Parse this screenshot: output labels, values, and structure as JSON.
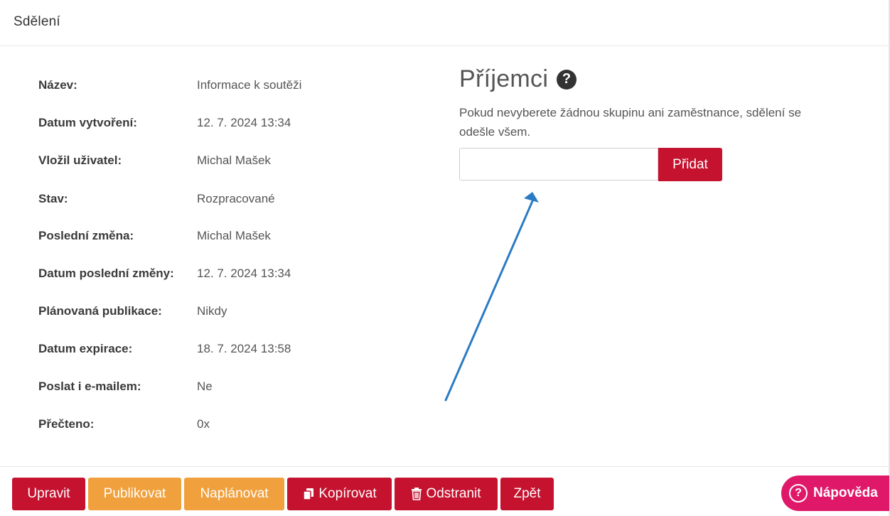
{
  "header": {
    "title": "Sdělení"
  },
  "details": [
    {
      "label": "Název:",
      "value": "Informace k soutěži"
    },
    {
      "label": "Datum vytvoření:",
      "value": "12. 7. 2024 13:34"
    },
    {
      "label": "Vložil uživatel:",
      "value": "Michal Mašek"
    },
    {
      "label": "Stav:",
      "value": "Rozpracované"
    },
    {
      "label": "Poslední změna:",
      "value": "Michal Mašek"
    },
    {
      "label": "Datum poslední změny:",
      "value": "12. 7. 2024 13:34"
    },
    {
      "label": "Plánovaná publikace:",
      "value": "Nikdy"
    },
    {
      "label": "Datum expirace:",
      "value": "18. 7. 2024 13:58"
    },
    {
      "label": "Poslat i e-mailem:",
      "value": "Ne"
    },
    {
      "label": "Přečteno:",
      "value": "0x"
    }
  ],
  "recipients": {
    "title": "Příjemci",
    "help_symbol": "?",
    "note": "Pokud nevyberete žádnou skupinu ani zaměstnance, sdělení se odešle všem.",
    "input_value": "",
    "add_label": "Přidat"
  },
  "toolbar": {
    "edit_label": "Upravit",
    "publish_label": "Publikovat",
    "schedule_label": "Naplánovat",
    "copy_label": "Kopírovat",
    "delete_label": "Odstranit",
    "back_label": "Zpět"
  },
  "help_fab": {
    "label": "Nápověda",
    "icon_symbol": "?"
  },
  "colors": {
    "primary_red": "#c4122f",
    "orange": "#f0a03c",
    "help_pink": "#e0186a",
    "annotation_arrow": "#2b7bc4"
  },
  "icons": {
    "help": "question-circle-icon",
    "copy": "copy-icon",
    "delete": "trash-icon",
    "annotation": "arrow-annotation-icon"
  }
}
